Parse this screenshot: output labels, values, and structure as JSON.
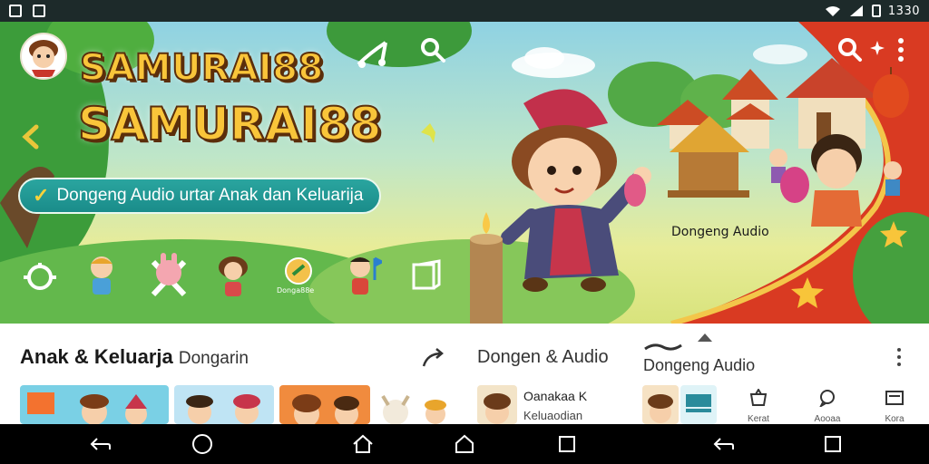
{
  "status_bar": {
    "time": "1330"
  },
  "hero": {
    "brand_line1": "SAMURAI88",
    "brand_line2": "SAMURAI88",
    "tagline": "Dongeng Audio urtar Anak dan Keluarija",
    "scene_label": "Dongeng Audio",
    "mini_label": "Donga88e",
    "icons": [
      "music-icon",
      "search-icon",
      "search-icon",
      "sparkle-icon",
      "more-icon",
      "back-chevron-icon"
    ]
  },
  "sections": {
    "main_title_bold": "Anak & Keluarja",
    "main_title_light": "Dongarin",
    "second_title": "Dongen & Audio",
    "third_title": "Dongeng Audio",
    "tile_title": "Oanakaa K",
    "tile_sub": "Keluaodian",
    "mini_items": [
      {
        "label": "Kerat"
      },
      {
        "label": "Aooaa"
      },
      {
        "label": "Kora"
      }
    ]
  },
  "colors": {
    "accent": "#1a8c8a",
    "brand": "#f9c53a",
    "banner_red": "#d93a22"
  }
}
